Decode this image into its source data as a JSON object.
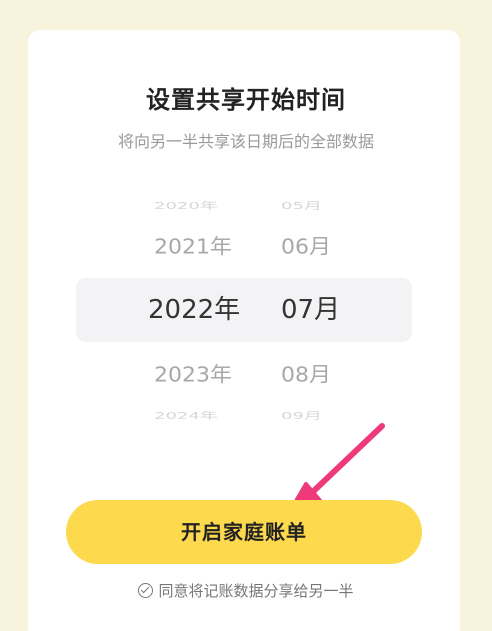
{
  "dialog": {
    "title": "设置共享开始时间",
    "subtitle": "将向另一半共享该日期后的全部数据"
  },
  "picker": {
    "rows": [
      {
        "year": "2020年",
        "month": "05月"
      },
      {
        "year": "2021年",
        "month": "06月"
      },
      {
        "year": "2022年",
        "month": "07月"
      },
      {
        "year": "2023年",
        "month": "08月"
      },
      {
        "year": "2024年",
        "month": "09月"
      }
    ],
    "selected_index": 2
  },
  "button": {
    "label": "开启家庭账单",
    "color": "#fdd94d"
  },
  "agreement": {
    "label": "同意将记账数据分享给另一半",
    "icon": "check-circle-icon"
  },
  "annotation": {
    "icon": "pointer-arrow-icon",
    "color": "#ee3a7a"
  }
}
